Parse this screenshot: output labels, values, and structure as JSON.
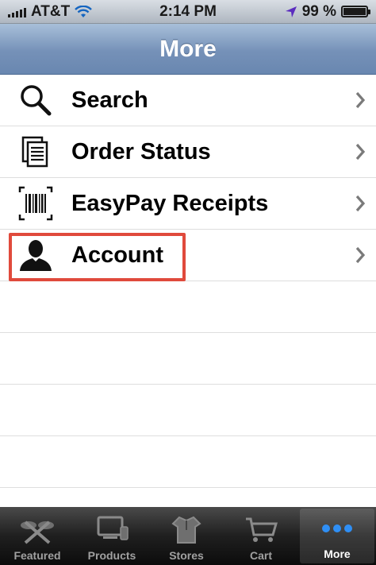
{
  "status_bar": {
    "carrier": "AT&T",
    "time": "2:14 PM",
    "battery_percent": "99 %",
    "battery_level": 0.99
  },
  "nav": {
    "title": "More"
  },
  "menu": {
    "items": [
      {
        "label": "Search",
        "icon": "search-icon"
      },
      {
        "label": "Order Status",
        "icon": "documents-icon"
      },
      {
        "label": "EasyPay Receipts",
        "icon": "barcode-icon"
      },
      {
        "label": "Account",
        "icon": "person-icon"
      }
    ],
    "highlight_color": "#e04a3c"
  },
  "tabs": [
    {
      "label": "Featured",
      "icon": "featured-icon",
      "active": false
    },
    {
      "label": "Products",
      "icon": "products-icon",
      "active": false
    },
    {
      "label": "Stores",
      "icon": "stores-icon",
      "active": false
    },
    {
      "label": "Cart",
      "icon": "cart-icon",
      "active": false
    },
    {
      "label": "More",
      "icon": "more-dots-icon",
      "active": true
    }
  ],
  "colors": {
    "nav_bar": "#7591b8",
    "active_tab_icon": "#2f8ff5"
  }
}
